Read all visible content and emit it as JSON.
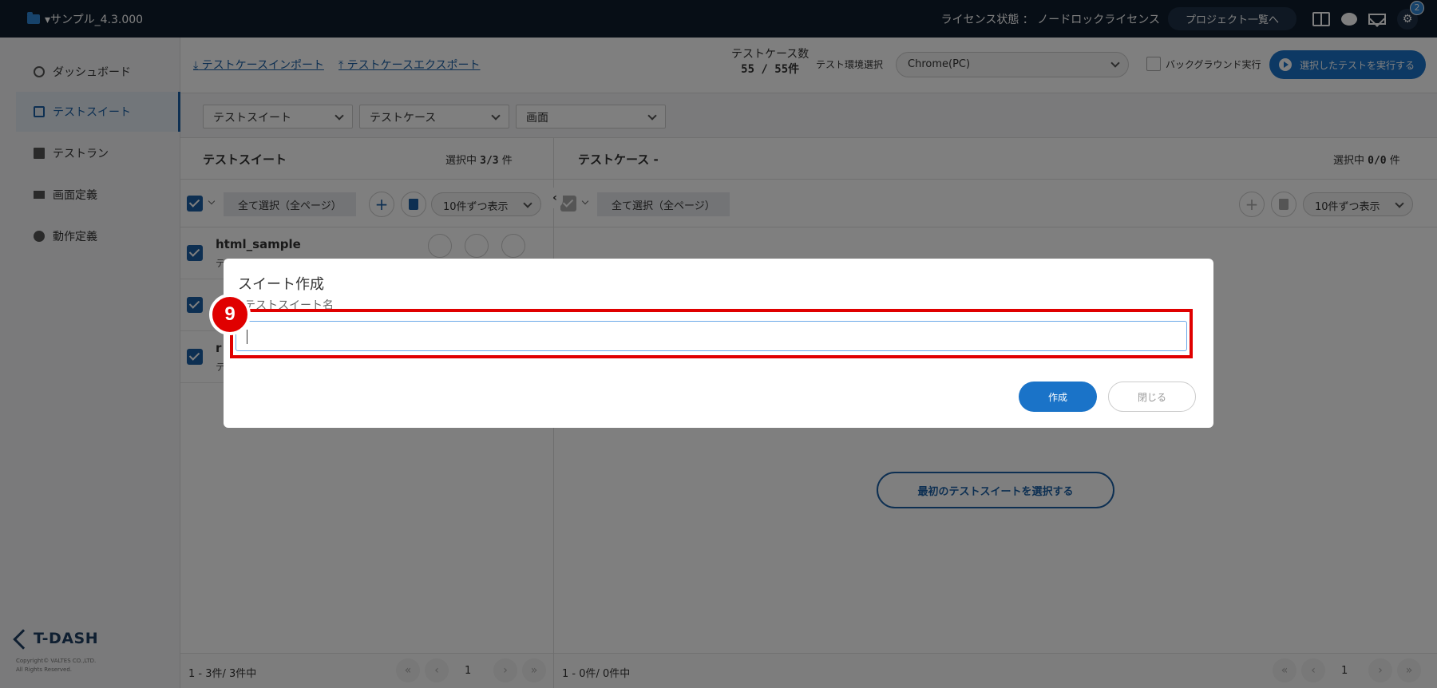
{
  "topbar": {
    "project": "▾サンプル_4.3.000",
    "license": "ライセンス状態 ： ノードロックライセンス",
    "project_list": "プロジェクト一覧へ",
    "notification_count": "2"
  },
  "sidebar": {
    "items": [
      {
        "label": "ダッシュボード",
        "icon": "clock-icon"
      },
      {
        "label": "テストスイート",
        "icon": "copy-icon"
      },
      {
        "label": "テストラン",
        "icon": "document-icon"
      },
      {
        "label": "画面定義",
        "icon": "monitor-icon"
      },
      {
        "label": "動作定義",
        "icon": "check-circle-icon"
      }
    ],
    "logo": "T-DASH",
    "copyright_1": "Copyright© VALTES CO.,LTD.",
    "copyright_2": "All Rights Reserved."
  },
  "toolbar": {
    "import": "⤓ テストケースインポート",
    "export": "⤒ テストケースエクスポート",
    "count_label": "テストケース数",
    "count_value": "55 / 55件",
    "env_label": "テスト環境選択",
    "env_value": "Chrome(PC)",
    "background_label": "バックグラウンド実行",
    "run_label": "選択したテストを実行する"
  },
  "filters": {
    "suite": "テストスイート",
    "case": "テストケース",
    "screen": "画面"
  },
  "left_panel": {
    "title": "テストスイート",
    "selected_prefix": "選択中",
    "selected_count": "3/3",
    "selected_suffix": "件",
    "select_all": "全て選択（全ページ）",
    "per_page": "10件ずつ表示",
    "rows": [
      {
        "name": "html_sample",
        "sub": "テ"
      },
      {
        "name": "",
        "sub": ""
      },
      {
        "name": "r",
        "sub": "テ"
      }
    ],
    "pager_count": "1 - 3件/ 3件中",
    "page": "1"
  },
  "right_panel": {
    "title": "テストケース -",
    "selected_prefix": "選択中",
    "selected_count": "0/0",
    "selected_suffix": "件",
    "select_all": "全て選択（全ページ）",
    "per_page": "10件ずつ表示",
    "first_suite": "最初のテストスイートを選択する",
    "pager_count": "1 - 0件/ 0件中",
    "page": "1"
  },
  "modal": {
    "title": "スイート作成",
    "field_label": "テストスイート名",
    "field_value": "",
    "marker": "9",
    "create": "作成",
    "close": "閉じる"
  }
}
